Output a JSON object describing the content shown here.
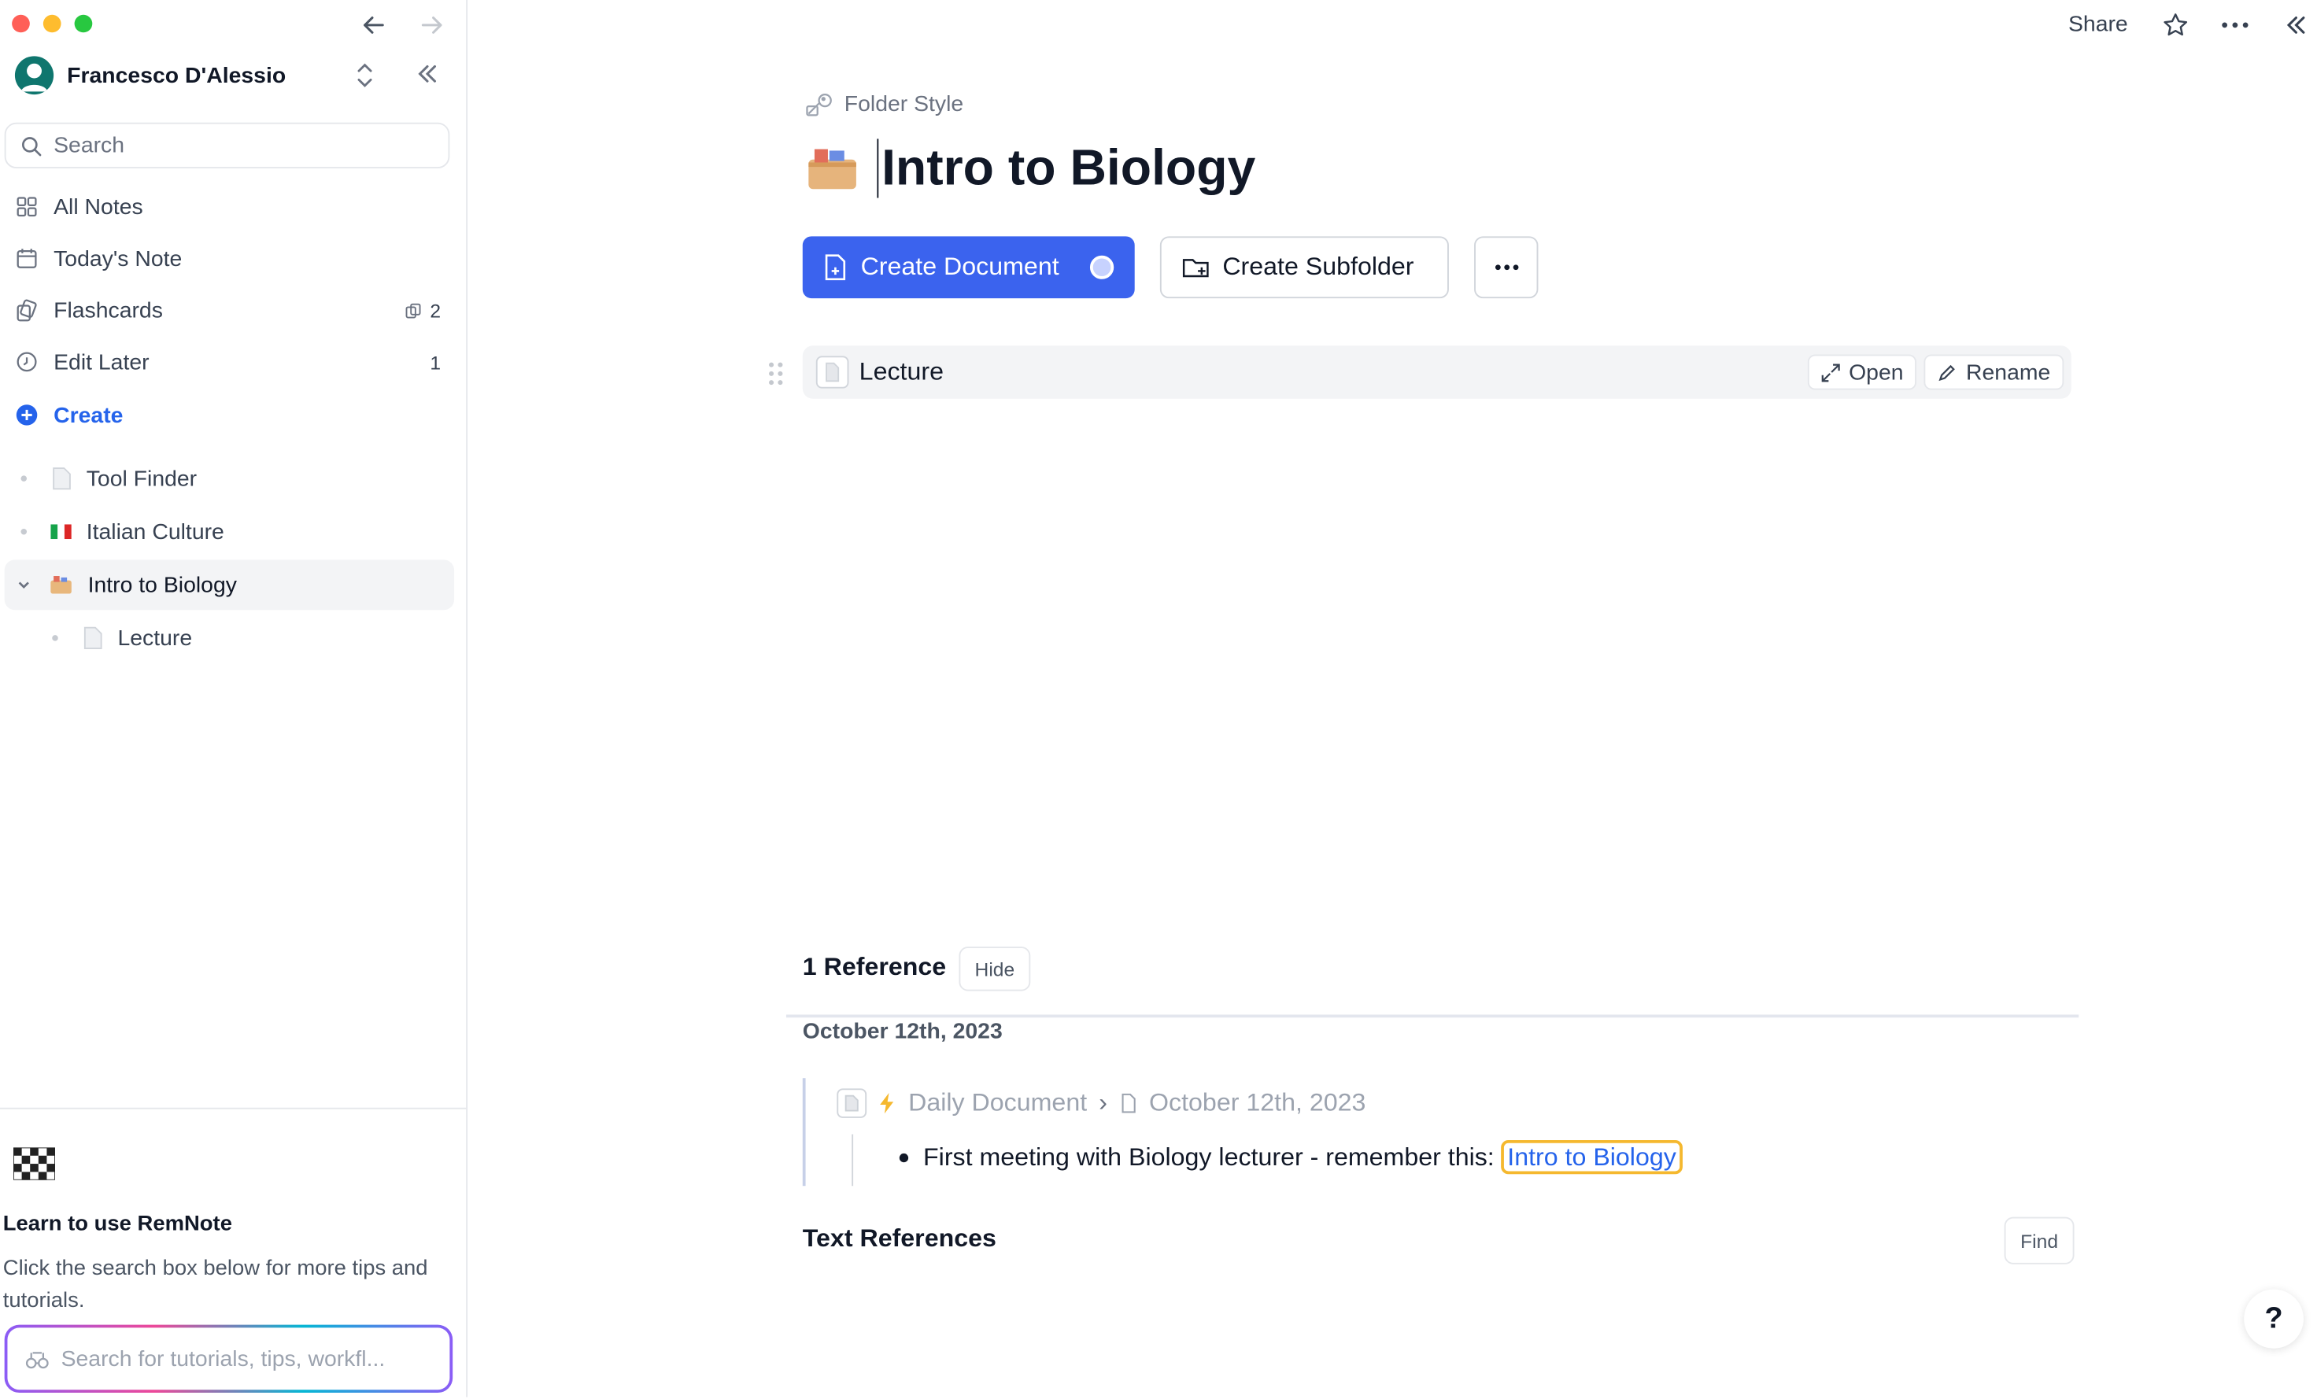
{
  "window": {
    "traffic": [
      "#ff5f57",
      "#febc2e",
      "#28c840"
    ]
  },
  "sidebar": {
    "user_name": "Francesco D'Alessio",
    "search_placeholder": "Search",
    "nav": [
      {
        "label": "All Notes",
        "icon": "grid-icon"
      },
      {
        "label": "Today's Note",
        "icon": "calendar-icon"
      },
      {
        "label": "Flashcards",
        "icon": "cards-icon",
        "count": "2"
      },
      {
        "label": "Edit Later",
        "icon": "clock-icon",
        "count": "1"
      }
    ],
    "create_label": "Create",
    "tree": [
      {
        "label": "Tool Finder",
        "icon": "document-icon"
      },
      {
        "label": "Italian Culture",
        "icon": "italy-flag-icon"
      },
      {
        "label": "Intro to Biology",
        "icon": "folder-icon",
        "expanded": true
      },
      {
        "label": "Lecture",
        "icon": "document-icon"
      }
    ],
    "learn_title": "Learn to use RemNote",
    "learn_text": "Click the search box below for more tips and tutorials.",
    "tutorial_search_placeholder": "Search for tutorials, tips, workfl..."
  },
  "topbar": {
    "share_label": "Share"
  },
  "page": {
    "breadcrumb": "Folder Style",
    "title": "Intro to Biology",
    "create_document_label": "Create Document",
    "create_subfolder_label": "Create Subfolder",
    "child": {
      "label": "Lecture",
      "open_label": "Open",
      "rename_label": "Rename"
    }
  },
  "references": {
    "heading": "1 Reference",
    "hide_label": "Hide",
    "date_group": "October 12th, 2023",
    "path": {
      "source": "Daily Document",
      "separator": "›",
      "target": "October 12th, 2023"
    },
    "bullet_text": "First meeting with Biology lecturer - remember this:",
    "link_text": "Intro to Biology",
    "text_refs_heading": "Text References",
    "find_label": "Find"
  },
  "help_label": "?",
  "colors": {
    "accent": "#3b63ee",
    "link": "#2563eb",
    "highlight": "#f5b82e"
  }
}
